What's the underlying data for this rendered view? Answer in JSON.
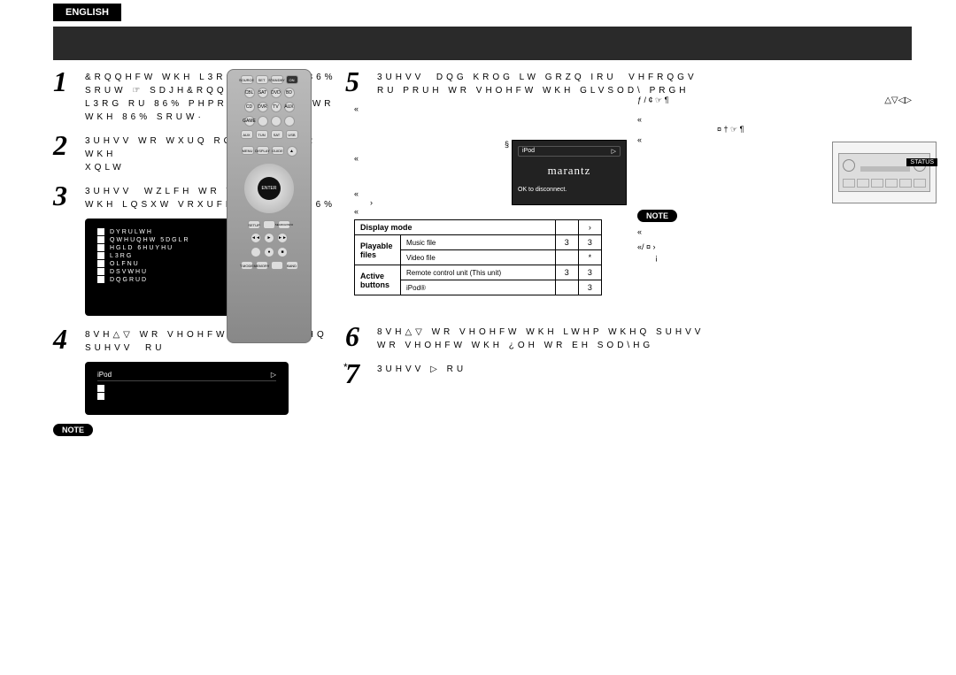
{
  "language_tab": "ENGLISH",
  "note_label": "NOTE",
  "steps": {
    "s1": "&RQQHFW WKH L3RG WR WKH 86%\nSRUW ☞ SDJH&RQQHFWLQJ DQ\nL3RG RU 86% PHPRU\\ GHYLFH WR\nWKH 86% SRUW·",
    "s2": "3UHVV WR WXUQ RQ SRZHU WR WKH\nXQLW",
    "s3": "3UHVV  WZLFH WR VZLWFK\nWKH LQSXW VRXUFH WR ±1(7 86%",
    "s4": "8VH△▽ WR VHOHFW ±L3RG WKHQ\nSUHVV  RU",
    "s5": "3UHVV  DQG KROG LW GRZQ IRU  VHFRQGV\nRU PRUH WR VHOHFW WKH GLVSOD\\ PRGH",
    "s6": "8VH△▽ WR VHOHFW WKH LWHP WKHQ SUHVV \nWR VHOHFW WKH ¿OH WR EH SOD\\HG",
    "s7": "3UHVV ▷ RU"
  },
  "screen1": {
    "items": [
      "DYRULWH",
      "QWHUQHW 5DGLR",
      "HGLD 6HUYHU",
      "L3RG",
      "OLFNU",
      "DSVWHU",
      "DQGRUD"
    ]
  },
  "screen2_title": "iPod",
  "remote": {
    "row1": [
      "SOURCE",
      "SET",
      "STANDBY",
      "ON"
    ],
    "row2": [
      "CBL",
      "SAT",
      "DVD",
      "BD"
    ],
    "row3": [
      "CD",
      "DVR",
      "TV",
      "AUX"
    ],
    "row4": [
      "GAME",
      "",
      "",
      "NET USB"
    ],
    "row5": [
      "AUX",
      "TUN",
      "SAT",
      "USB"
    ],
    "mid": [
      "MENU",
      "DISPLAY",
      "GUIDE",
      ""
    ],
    "enter": "ENTER",
    "bot": [
      "SETUP",
      "",
      "SEARCH/INFO"
    ],
    "media": [
      "◄◄",
      "►",
      "►►",
      "",
      "●",
      "■"
    ],
    "lower": [
      "T.MODE",
      "MEMORY",
      "",
      "BAND"
    ]
  },
  "display_mode_table": {
    "head": [
      "Display mode",
      "",
      "›"
    ],
    "rows": [
      {
        "group": "Playable files",
        "label": "Music file",
        "c1": "3",
        "c2": "3"
      },
      {
        "group": "",
        "label": "Video file",
        "c1": "",
        "c2": "*"
      },
      {
        "group": "Active buttons",
        "label": "Remote control unit (This unit)",
        "c1": "3",
        "c2": "3"
      },
      {
        "group": "",
        "label": "iPod®",
        "c1": "",
        "c2": "3"
      }
    ]
  },
  "marantz": {
    "brand": "marantz",
    "top_label": "iPod",
    "top_right": "▷",
    "bottom": "OK to disconnect."
  },
  "right_text": {
    "line1": "ƒ     / ¢ ☞ ¶",
    "line2": "¤ † ☞ ¶",
    "line3": "«",
    "line4": "«/   ¤  ›",
    "line5": "¡"
  },
  "diagram_label": "STATUS",
  "mid_lines": [
    "«",
    "«",
    "§",
    "«",
    "›",
    "«"
  ],
  "sym_panel": "△▽◁▷",
  "footnote": "*"
}
